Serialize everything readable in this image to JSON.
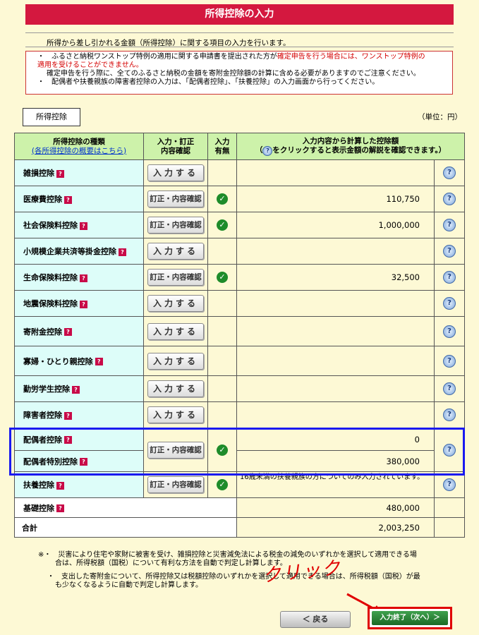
{
  "page": {
    "title": "所得控除の入力",
    "intro": "所得から差し引かれる金額（所得控除）に関する項目の入力を行います。",
    "notice": {
      "line1_prefix": "・　ふるさと納税ワンストップ特例の適用に関する申請書を提出された方が",
      "line1_red": "確定申告を行う場合には、ワンストップ特例の",
      "line2_red": "適用を受けることができません。",
      "line3": "確定申告を行う際に、全てのふるさと納税の金額を寄附金控除額の計算に含める必要がありますのでご注意ください。",
      "line4": "・　配偶者や扶養親族の障害者控除の入力は、「配偶者控除」、「扶養控除」の入力画面から行ってください。"
    },
    "section_label": "所得控除",
    "unit": "（単位：円）"
  },
  "table": {
    "headers": {
      "type": "所得控除の種類",
      "type_link": "(各所得控除の概要はこちら)",
      "action_line1": "入力・訂正",
      "action_line2": "内容確認",
      "status_line1": "入力",
      "status_line2": "有無",
      "amount_line1": "入力内容から計算した控除額",
      "amount_line2": "をクリックすると表示金額の解説を確認できます。）",
      "amount_line2_prefix": "（"
    },
    "rows": [
      {
        "name": "雑損控除",
        "button": "入力する",
        "entered": false,
        "amount": ""
      },
      {
        "name": "医療費控除",
        "button": "訂正・内容確認",
        "entered": true,
        "amount": "110,750"
      },
      {
        "name": "社会保険料控除",
        "button": "訂正・内容確認",
        "entered": true,
        "amount": "1,000,000"
      },
      {
        "name": "小規模企業共済等掛金控除",
        "button": "入力する",
        "entered": false,
        "amount": ""
      },
      {
        "name": "生命保険料控除",
        "button": "訂正・内容確認",
        "entered": true,
        "amount": "32,500"
      },
      {
        "name": "地震保険料控除",
        "button": "入力する",
        "entered": false,
        "amount": ""
      },
      {
        "name": "寄附金控除",
        "button": "入力する",
        "entered": false,
        "amount": ""
      },
      {
        "name": "寡婦・ひとり親控除",
        "button": "入力する",
        "entered": false,
        "amount": ""
      },
      {
        "name": "勤労学生控除",
        "button": "入力する",
        "entered": false,
        "amount": ""
      },
      {
        "name": "障害者控除",
        "button": "入力する",
        "entered": false,
        "amount": ""
      }
    ],
    "spouse": {
      "name1": "配偶者控除",
      "name2": "配偶者特別控除",
      "button": "訂正・内容確認",
      "entered": true,
      "amount1": "0",
      "amount2": "380,000"
    },
    "dependents": {
      "name": "扶養控除",
      "button": "訂正・内容確認",
      "entered": true,
      "note": "16歳未満の扶養親族の方についてのみ入力されています。"
    },
    "basic": {
      "name": "基礎控除",
      "amount": "480,000"
    },
    "total": {
      "name": "合計",
      "amount": "2,003,250"
    }
  },
  "footnotes": {
    "f1_line1": "※・　災害により住宅や家財に被害を受け、雑損控除と災害減免法による税金の減免のいずれかを選択して適用できる場",
    "f1_line2": "合は、所得税額（国税）について有利な方法を自動で判定し計算します。",
    "f2_line1": "・　支出した寄附金について、所得控除又は税額控除のいずれかを選択して適用できる場合は、所得税額（国税）が最",
    "f2_line2": "も少なくなるように自動で判定し計算します。"
  },
  "annotation": {
    "click_text": "クリック",
    "color": "#e00000"
  },
  "nav": {
    "back_label": "＜ 戻る",
    "next_label": "入力終了（次へ）＞"
  },
  "icons": {
    "help": "help-bubble-icon",
    "question": "question-mark-icon",
    "check": "check-circle-icon"
  }
}
